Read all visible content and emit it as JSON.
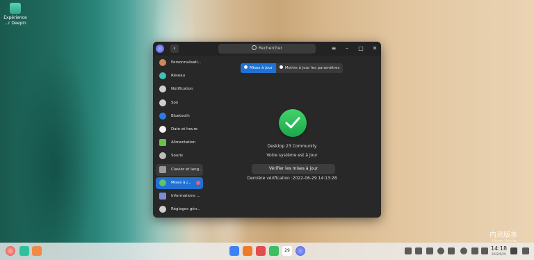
{
  "desktop": {
    "icon_label_line1": "Expérience",
    "icon_label_line2": "...r Deepin",
    "watermark_big": "内测版本",
    "watermark_small": "Hänen Version"
  },
  "window": {
    "search_placeholder": "Rechercher",
    "back_glyph": "‹",
    "menu_glyph": "≡",
    "minimize_glyph": "–",
    "maximize_glyph": "□",
    "close_glyph": "✕",
    "sidebar": [
      {
        "label": "Personnalisati...",
        "icon": "personalization-icon",
        "color": "#c98a5a"
      },
      {
        "label": "Réseau",
        "icon": "network-icon",
        "color": "#3fc0b8"
      },
      {
        "label": "Notification",
        "icon": "notification-icon",
        "color": "#cfcfcf"
      },
      {
        "label": "Son",
        "icon": "sound-icon",
        "color": "#cfcfcf"
      },
      {
        "label": "Bluetooth",
        "icon": "bluetooth-icon",
        "color": "#2c7be5"
      },
      {
        "label": "Date et heure",
        "icon": "clock-icon",
        "color": "#f2f2f2"
      },
      {
        "label": "Alimentation",
        "icon": "battery-icon",
        "color": "#6bc24a"
      },
      {
        "label": "Souris",
        "icon": "mouse-icon",
        "color": "#bdbdbd"
      },
      {
        "label": "Clavier et lang...",
        "icon": "keyboard-icon",
        "color": "#9a9a9a"
      },
      {
        "label": "Mises à j...",
        "icon": "update-icon",
        "color": "#5ec36b"
      },
      {
        "label": "Informations ...",
        "icon": "info-icon",
        "color": "#7d8cd6"
      },
      {
        "label": "Réglages gén...",
        "icon": "settings-icon",
        "color": "#cfcfcf"
      }
    ],
    "tabs": [
      "Mises à jour",
      "Mettre à jour les paramètres"
    ],
    "status_line1": "Desktop 23 Community",
    "status_line2": "Votre système est à jour",
    "verify_button": "Vérifier les mises à jour",
    "last_check": "Dernière vérification :2022-06-29 14:13:28"
  },
  "taskbar": {
    "time": "14:18",
    "date": "2022/6/29",
    "calendar_day": "29"
  },
  "colors": {
    "accent": "#1f71d4",
    "success": "#2dbf57",
    "badge": "#ff5a67"
  }
}
